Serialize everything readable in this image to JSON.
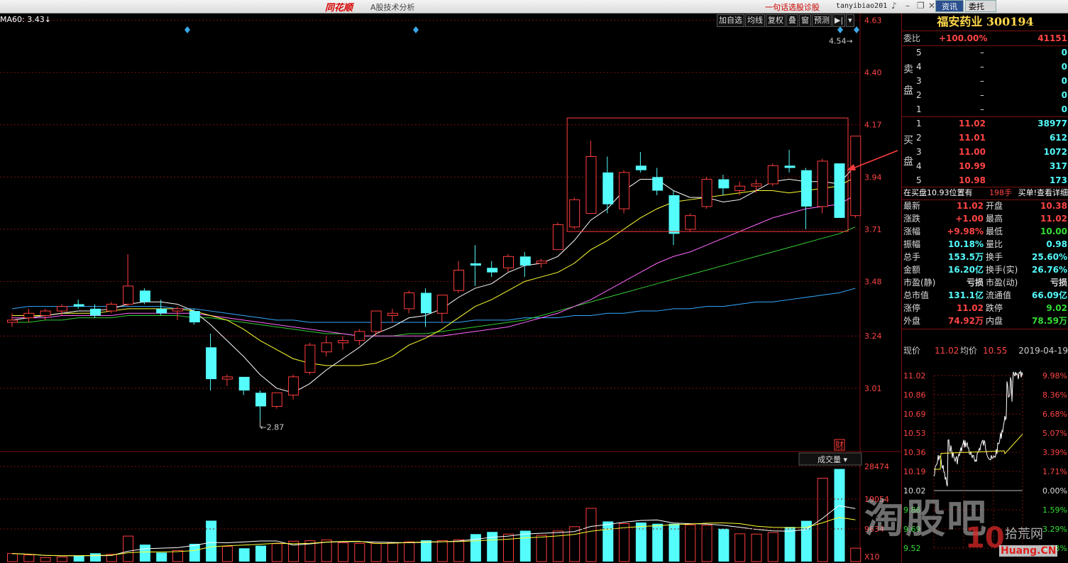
{
  "titlebar": {
    "logo": "同花顺",
    "app_name": "A股技术分析",
    "promo": "一句话选股诊股",
    "user": "tanyibiao201",
    "btn_news": "资讯",
    "btn_order": "委托"
  },
  "chart": {
    "ma_label": "MA60: 3.43↓",
    "toolbar": [
      "加自选",
      "均线",
      "复权",
      "叠",
      "窗",
      "预测"
    ],
    "price_ticks": [
      "4.63",
      "4.40",
      "4.17",
      "3.94",
      "3.71",
      "3.48",
      "3.24",
      "3.01"
    ],
    "high_marker": "4.54",
    "low_marker": "2.87",
    "cai_label": "财",
    "volume_label": "成交量",
    "volume_ticks": [
      "28474",
      "19054",
      "9634"
    ],
    "volume_unit": "X10",
    "colors": {
      "up": "#ff3c3c",
      "down": "#54fcfc",
      "ma5": "#ffffff",
      "ma10": "#ffff33",
      "ma20": "#ff66ff",
      "ma30": "#33cc33",
      "ma60": "#33aaff"
    }
  },
  "chart_data": {
    "type": "candlestick",
    "price_axis": [
      2.8,
      4.66
    ],
    "candles": [
      {
        "o": 3.3,
        "h": 3.34,
        "l": 3.28,
        "c": 3.31
      },
      {
        "o": 3.32,
        "h": 3.36,
        "l": 3.3,
        "c": 3.34
      },
      {
        "o": 3.33,
        "h": 3.36,
        "l": 3.31,
        "c": 3.35
      },
      {
        "o": 3.35,
        "h": 3.38,
        "l": 3.33,
        "c": 3.37
      },
      {
        "o": 3.38,
        "h": 3.4,
        "l": 3.36,
        "c": 3.37
      },
      {
        "o": 3.36,
        "h": 3.38,
        "l": 3.32,
        "c": 3.33
      },
      {
        "o": 3.35,
        "h": 3.39,
        "l": 3.34,
        "c": 3.38
      },
      {
        "o": 3.38,
        "h": 3.6,
        "l": 3.37,
        "c": 3.46
      },
      {
        "o": 3.44,
        "h": 3.45,
        "l": 3.38,
        "c": 3.39
      },
      {
        "o": 3.36,
        "h": 3.4,
        "l": 3.33,
        "c": 3.34
      },
      {
        "o": 3.35,
        "h": 3.37,
        "l": 3.31,
        "c": 3.36
      },
      {
        "o": 3.35,
        "h": 3.36,
        "l": 3.29,
        "c": 3.3
      },
      {
        "o": 3.19,
        "h": 3.25,
        "l": 3.0,
        "c": 3.05
      },
      {
        "o": 3.05,
        "h": 3.07,
        "l": 3.02,
        "c": 3.06
      },
      {
        "o": 3.06,
        "h": 3.06,
        "l": 2.98,
        "c": 3.0
      },
      {
        "o": 2.99,
        "h": 3.0,
        "l": 2.87,
        "c": 2.93
      },
      {
        "o": 2.93,
        "h": 2.99,
        "l": 2.92,
        "c": 2.99
      },
      {
        "o": 2.98,
        "h": 3.07,
        "l": 2.96,
        "c": 3.06
      },
      {
        "o": 3.08,
        "h": 3.21,
        "l": 3.07,
        "c": 3.2
      },
      {
        "o": 3.17,
        "h": 3.24,
        "l": 3.15,
        "c": 3.21
      },
      {
        "o": 3.21,
        "h": 3.24,
        "l": 3.18,
        "c": 3.22
      },
      {
        "o": 3.22,
        "h": 3.27,
        "l": 3.2,
        "c": 3.26
      },
      {
        "o": 3.26,
        "h": 3.35,
        "l": 3.24,
        "c": 3.35
      },
      {
        "o": 3.33,
        "h": 3.36,
        "l": 3.3,
        "c": 3.34
      },
      {
        "o": 3.36,
        "h": 3.44,
        "l": 3.34,
        "c": 3.43
      },
      {
        "o": 3.43,
        "h": 3.45,
        "l": 3.28,
        "c": 3.34
      },
      {
        "o": 3.34,
        "h": 3.42,
        "l": 3.3,
        "c": 3.42
      },
      {
        "o": 3.44,
        "h": 3.57,
        "l": 3.43,
        "c": 3.53
      },
      {
        "o": 3.56,
        "h": 3.64,
        "l": 3.46,
        "c": 3.55
      },
      {
        "o": 3.54,
        "h": 3.57,
        "l": 3.5,
        "c": 3.52
      },
      {
        "o": 3.54,
        "h": 3.6,
        "l": 3.52,
        "c": 3.59
      },
      {
        "o": 3.59,
        "h": 3.61,
        "l": 3.5,
        "c": 3.55
      },
      {
        "o": 3.56,
        "h": 3.58,
        "l": 3.54,
        "c": 3.57
      },
      {
        "o": 3.62,
        "h": 3.74,
        "l": 3.62,
        "c": 3.73
      },
      {
        "o": 3.72,
        "h": 3.85,
        "l": 3.71,
        "c": 3.84
      },
      {
        "o": 3.78,
        "h": 4.1,
        "l": 3.78,
        "c": 4.03
      },
      {
        "o": 3.96,
        "h": 4.03,
        "l": 3.78,
        "c": 3.82
      },
      {
        "o": 3.8,
        "h": 3.97,
        "l": 3.78,
        "c": 3.96
      },
      {
        "o": 3.99,
        "h": 4.05,
        "l": 3.96,
        "c": 3.97
      },
      {
        "o": 3.94,
        "h": 3.98,
        "l": 3.86,
        "c": 3.88
      },
      {
        "o": 3.86,
        "h": 3.88,
        "l": 3.64,
        "c": 3.69
      },
      {
        "o": 3.71,
        "h": 3.78,
        "l": 3.7,
        "c": 3.77
      },
      {
        "o": 3.81,
        "h": 3.94,
        "l": 3.8,
        "c": 3.93
      },
      {
        "o": 3.93,
        "h": 3.95,
        "l": 3.86,
        "c": 3.89
      },
      {
        "o": 3.88,
        "h": 3.92,
        "l": 3.86,
        "c": 3.9
      },
      {
        "o": 3.9,
        "h": 3.93,
        "l": 3.87,
        "c": 3.91
      },
      {
        "o": 3.91,
        "h": 4.0,
        "l": 3.9,
        "c": 3.99
      },
      {
        "o": 3.99,
        "h": 4.06,
        "l": 3.96,
        "c": 3.98
      },
      {
        "o": 3.97,
        "h": 3.98,
        "l": 3.71,
        "c": 3.81
      },
      {
        "o": 3.81,
        "h": 4.02,
        "l": 3.78,
        "c": 4.01
      },
      {
        "o": 4.0,
        "h": 4.0,
        "l": 3.76,
        "c": 3.76
      },
      {
        "o": 3.77,
        "h": 4.12,
        "l": 3.76,
        "c": 4.12
      }
    ],
    "volumes": [
      520,
      430,
      260,
      300,
      380,
      540,
      470,
      1650,
      1100,
      580,
      720,
      1150,
      2650,
      980,
      860,
      1030,
      1160,
      1320,
      1350,
      1400,
      1220,
      1180,
      1180,
      1220,
      1280,
      1380,
      1360,
      1420,
      1780,
      1920,
      1780,
      2000,
      1700,
      1980,
      2260,
      3450,
      2600,
      2460,
      2530,
      2450,
      2450,
      2380,
      2350,
      2130,
      1800,
      1780,
      1880,
      2240,
      2640,
      5400,
      6000,
      870
    ],
    "ma5": [
      3.31,
      3.32,
      3.33,
      3.34,
      3.35,
      3.35,
      3.36,
      3.38,
      3.39,
      3.39,
      3.38,
      3.35,
      3.29,
      3.22,
      3.15,
      3.07,
      3.01,
      2.99,
      3.03,
      3.09,
      3.14,
      3.19,
      3.25,
      3.28,
      3.32,
      3.33,
      3.36,
      3.41,
      3.45,
      3.47,
      3.52,
      3.55,
      3.56,
      3.59,
      3.66,
      3.75,
      3.8,
      3.88,
      3.93,
      3.93,
      3.88,
      3.85,
      3.85,
      3.83,
      3.84,
      3.88,
      3.92,
      3.93,
      3.92,
      3.92,
      3.91,
      3.99
    ],
    "ma10": [
      3.33,
      3.33,
      3.33,
      3.34,
      3.34,
      3.34,
      3.35,
      3.36,
      3.36,
      3.36,
      3.36,
      3.35,
      3.33,
      3.31,
      3.27,
      3.22,
      3.18,
      3.14,
      3.12,
      3.11,
      3.11,
      3.11,
      3.12,
      3.15,
      3.2,
      3.23,
      3.27,
      3.32,
      3.37,
      3.4,
      3.44,
      3.48,
      3.5,
      3.52,
      3.56,
      3.62,
      3.66,
      3.71,
      3.76,
      3.8,
      3.83,
      3.84,
      3.85,
      3.86,
      3.87,
      3.88,
      3.88,
      3.87,
      3.88,
      3.89,
      3.9,
      3.94
    ],
    "ma20": [
      3.32,
      3.32,
      3.32,
      3.33,
      3.33,
      3.33,
      3.33,
      3.34,
      3.34,
      3.34,
      3.34,
      3.34,
      3.33,
      3.32,
      3.31,
      3.3,
      3.29,
      3.28,
      3.27,
      3.26,
      3.25,
      3.24,
      3.24,
      3.24,
      3.24,
      3.24,
      3.24,
      3.25,
      3.26,
      3.27,
      3.28,
      3.3,
      3.32,
      3.34,
      3.37,
      3.4,
      3.44,
      3.48,
      3.52,
      3.56,
      3.59,
      3.61,
      3.64,
      3.67,
      3.7,
      3.73,
      3.76,
      3.78,
      3.8,
      3.81,
      3.82,
      3.86
    ],
    "ma30": [
      3.3,
      3.3,
      3.31,
      3.31,
      3.32,
      3.32,
      3.32,
      3.33,
      3.33,
      3.33,
      3.33,
      3.32,
      3.32,
      3.31,
      3.3,
      3.29,
      3.28,
      3.27,
      3.26,
      3.25,
      3.25,
      3.24,
      3.24,
      3.24,
      3.25,
      3.25,
      3.26,
      3.27,
      3.28,
      3.29,
      3.3,
      3.31,
      3.33,
      3.35,
      3.37,
      3.39,
      3.41,
      3.43,
      3.45,
      3.47,
      3.49,
      3.51,
      3.53,
      3.55,
      3.57,
      3.59,
      3.61,
      3.63,
      3.65,
      3.67,
      3.69,
      3.72
    ],
    "ma60": [
      3.36,
      3.37,
      3.37,
      3.37,
      3.37,
      3.37,
      3.37,
      3.37,
      3.37,
      3.37,
      3.36,
      3.36,
      3.35,
      3.34,
      3.33,
      3.32,
      3.31,
      3.31,
      3.3,
      3.3,
      3.3,
      3.3,
      3.3,
      3.3,
      3.3,
      3.3,
      3.3,
      3.3,
      3.31,
      3.31,
      3.31,
      3.32,
      3.32,
      3.32,
      3.33,
      3.33,
      3.34,
      3.34,
      3.35,
      3.35,
      3.36,
      3.36,
      3.37,
      3.37,
      3.38,
      3.39,
      3.39,
      3.4,
      3.41,
      3.42,
      3.43,
      3.45
    ]
  },
  "panel": {
    "stock_name": "福安药业 300194",
    "weibi_label": "委比",
    "weibi_pct": "+100.00%",
    "weibi_val": "41151",
    "sell_label1": "卖",
    "sell_label2": "盘",
    "buy_label1": "买",
    "buy_label2": "盘",
    "sell_rows": [
      {
        "lvl": "5",
        "price": "–",
        "vol": "0"
      },
      {
        "lvl": "4",
        "price": "–",
        "vol": "0"
      },
      {
        "lvl": "3",
        "price": "–",
        "vol": "0"
      },
      {
        "lvl": "2",
        "price": "–",
        "vol": "0"
      },
      {
        "lvl": "1",
        "price": "–",
        "vol": "0"
      }
    ],
    "buy_rows": [
      {
        "lvl": "1",
        "price": "11.02",
        "vol": "38977"
      },
      {
        "lvl": "2",
        "price": "11.01",
        "vol": "612"
      },
      {
        "lvl": "3",
        "price": "11.00",
        "vol": "1072"
      },
      {
        "lvl": "4",
        "price": "10.99",
        "vol": "317"
      },
      {
        "lvl": "5",
        "price": "10.98",
        "vol": "173"
      }
    ],
    "queue_text": "在买盘10.93位置有",
    "queue_count": "198手",
    "queue_link": "买单!查看详细",
    "quotes": [
      {
        "l1": "最新",
        "v1": "11.02",
        "l2": "开盘",
        "v2": "10.38"
      },
      {
        "l1": "涨跌",
        "v1": "+1.00",
        "l2": "最高",
        "v2": "11.02"
      },
      {
        "l1": "涨幅",
        "v1": "+9.98%",
        "l2": "最低",
        "v2": "10.00"
      },
      {
        "l1": "振幅",
        "v1": "10.18%",
        "l2": "量比",
        "v2": "0.98"
      },
      {
        "l1": "总手",
        "v1": "153.5万",
        "l2": "换手",
        "v2": "25.60%"
      },
      {
        "l1": "金额",
        "v1": "16.20亿",
        "l2": "换手(实)",
        "v2": "26.76%"
      },
      {
        "l1": "市盈(静)",
        "v1": "亏损",
        "l2": "市盈(动)",
        "v2": "亏损"
      },
      {
        "l1": "总市值",
        "v1": "131.1亿",
        "l2": "流通值",
        "v2": "66.09亿"
      },
      {
        "l1": "涨停",
        "v1": "11.02",
        "l2": "跌停",
        "v2": "9.02"
      },
      {
        "l1": "外盘",
        "v1": "74.92万",
        "l2": "内盘",
        "v2": "78.59万"
      }
    ],
    "mini_now_label": "现价",
    "mini_now": "11.02",
    "mini_avg_label": "均价",
    "mini_avg": "10.55",
    "mini_date": "2019-04-19",
    "mini_prices": [
      "11.02",
      "10.86",
      "10.69",
      "10.53",
      "10.36",
      "10.19",
      "10.02",
      "9.86",
      "9.69",
      "9.52"
    ],
    "mini_pcts": [
      "9.98%",
      "8.36%",
      "6.68%",
      "5.07%",
      "3.39%",
      "1.71%",
      "0.00%",
      "1.59%",
      "3.29%",
      "4.98%"
    ]
  },
  "watermark": {
    "main": "淘股吧",
    "site_num": "10",
    "site_name": "拾荒网",
    "site_url": "Huang.CN"
  }
}
